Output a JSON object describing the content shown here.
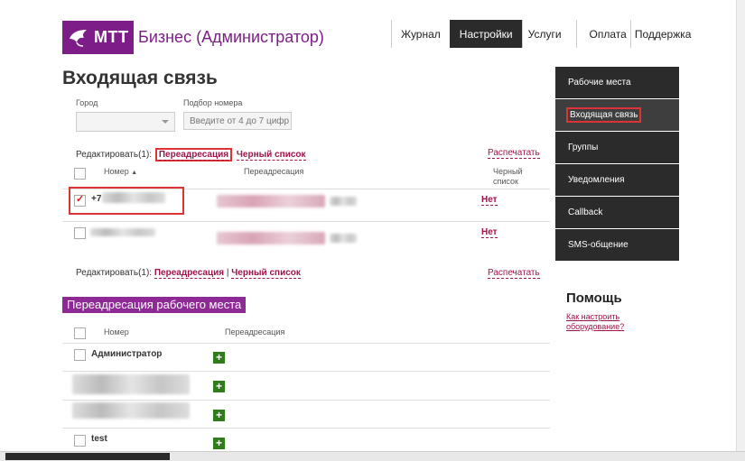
{
  "header": {
    "logo_mark": "МТТ",
    "logo_text": "Бизнес (Администратор)",
    "nav": [
      {
        "label": "Журнал",
        "active": false
      },
      {
        "label": "Настройки",
        "active": true
      },
      {
        "label": "Услуги",
        "active": false
      },
      {
        "label": "Оплата",
        "active": false
      },
      {
        "label": "Поддержка",
        "active": false
      }
    ]
  },
  "page_title": "Входящая связь",
  "filters": {
    "city_label": "Город",
    "city_value": "",
    "number_label": "Подбор номера",
    "number_placeholder": "Введите от 4 до 7 цифр"
  },
  "edit_bar": {
    "prefix": "Редактировать(1):",
    "forwarding": "Переадресация",
    "separator": "|",
    "blacklist": "Черный список",
    "print": "Распечатать"
  },
  "table1": {
    "col_number": "Номер",
    "sort_icon": "▲",
    "col_forwarding": "Переадресация",
    "col_blacklist": "Черный список",
    "rows": [
      {
        "number_prefix": "+7",
        "checked": true,
        "blacklist": "Нет"
      },
      {
        "number_prefix": "",
        "checked": false,
        "blacklist": "Нет"
      }
    ]
  },
  "section2": {
    "title": "Переадресация рабочего места",
    "col_number": "Номер",
    "col_forwarding": "Переадресация",
    "rows": [
      {
        "name": "Администратор",
        "add": "+"
      },
      {
        "name": "",
        "add": "+"
      },
      {
        "name": "",
        "add": "+"
      },
      {
        "name": "test",
        "add": "+"
      }
    ]
  },
  "sidebar": {
    "items": [
      {
        "label": "Рабочие места",
        "active": false
      },
      {
        "label": "Входящая связь",
        "active": true
      },
      {
        "label": "Группы",
        "active": false
      },
      {
        "label": "Уведомления",
        "active": false
      },
      {
        "label": "Callback",
        "active": false
      },
      {
        "label": "SMS-общение",
        "active": false
      }
    ],
    "help_title": "Помощь",
    "help_link": "Как настроить оборудование?"
  },
  "colors": {
    "brand": "#7d1e88",
    "link": "#a0124a",
    "nav_active": "#2b2b2b",
    "add_button": "#2e7d1a",
    "highlight": "#dd3333"
  }
}
